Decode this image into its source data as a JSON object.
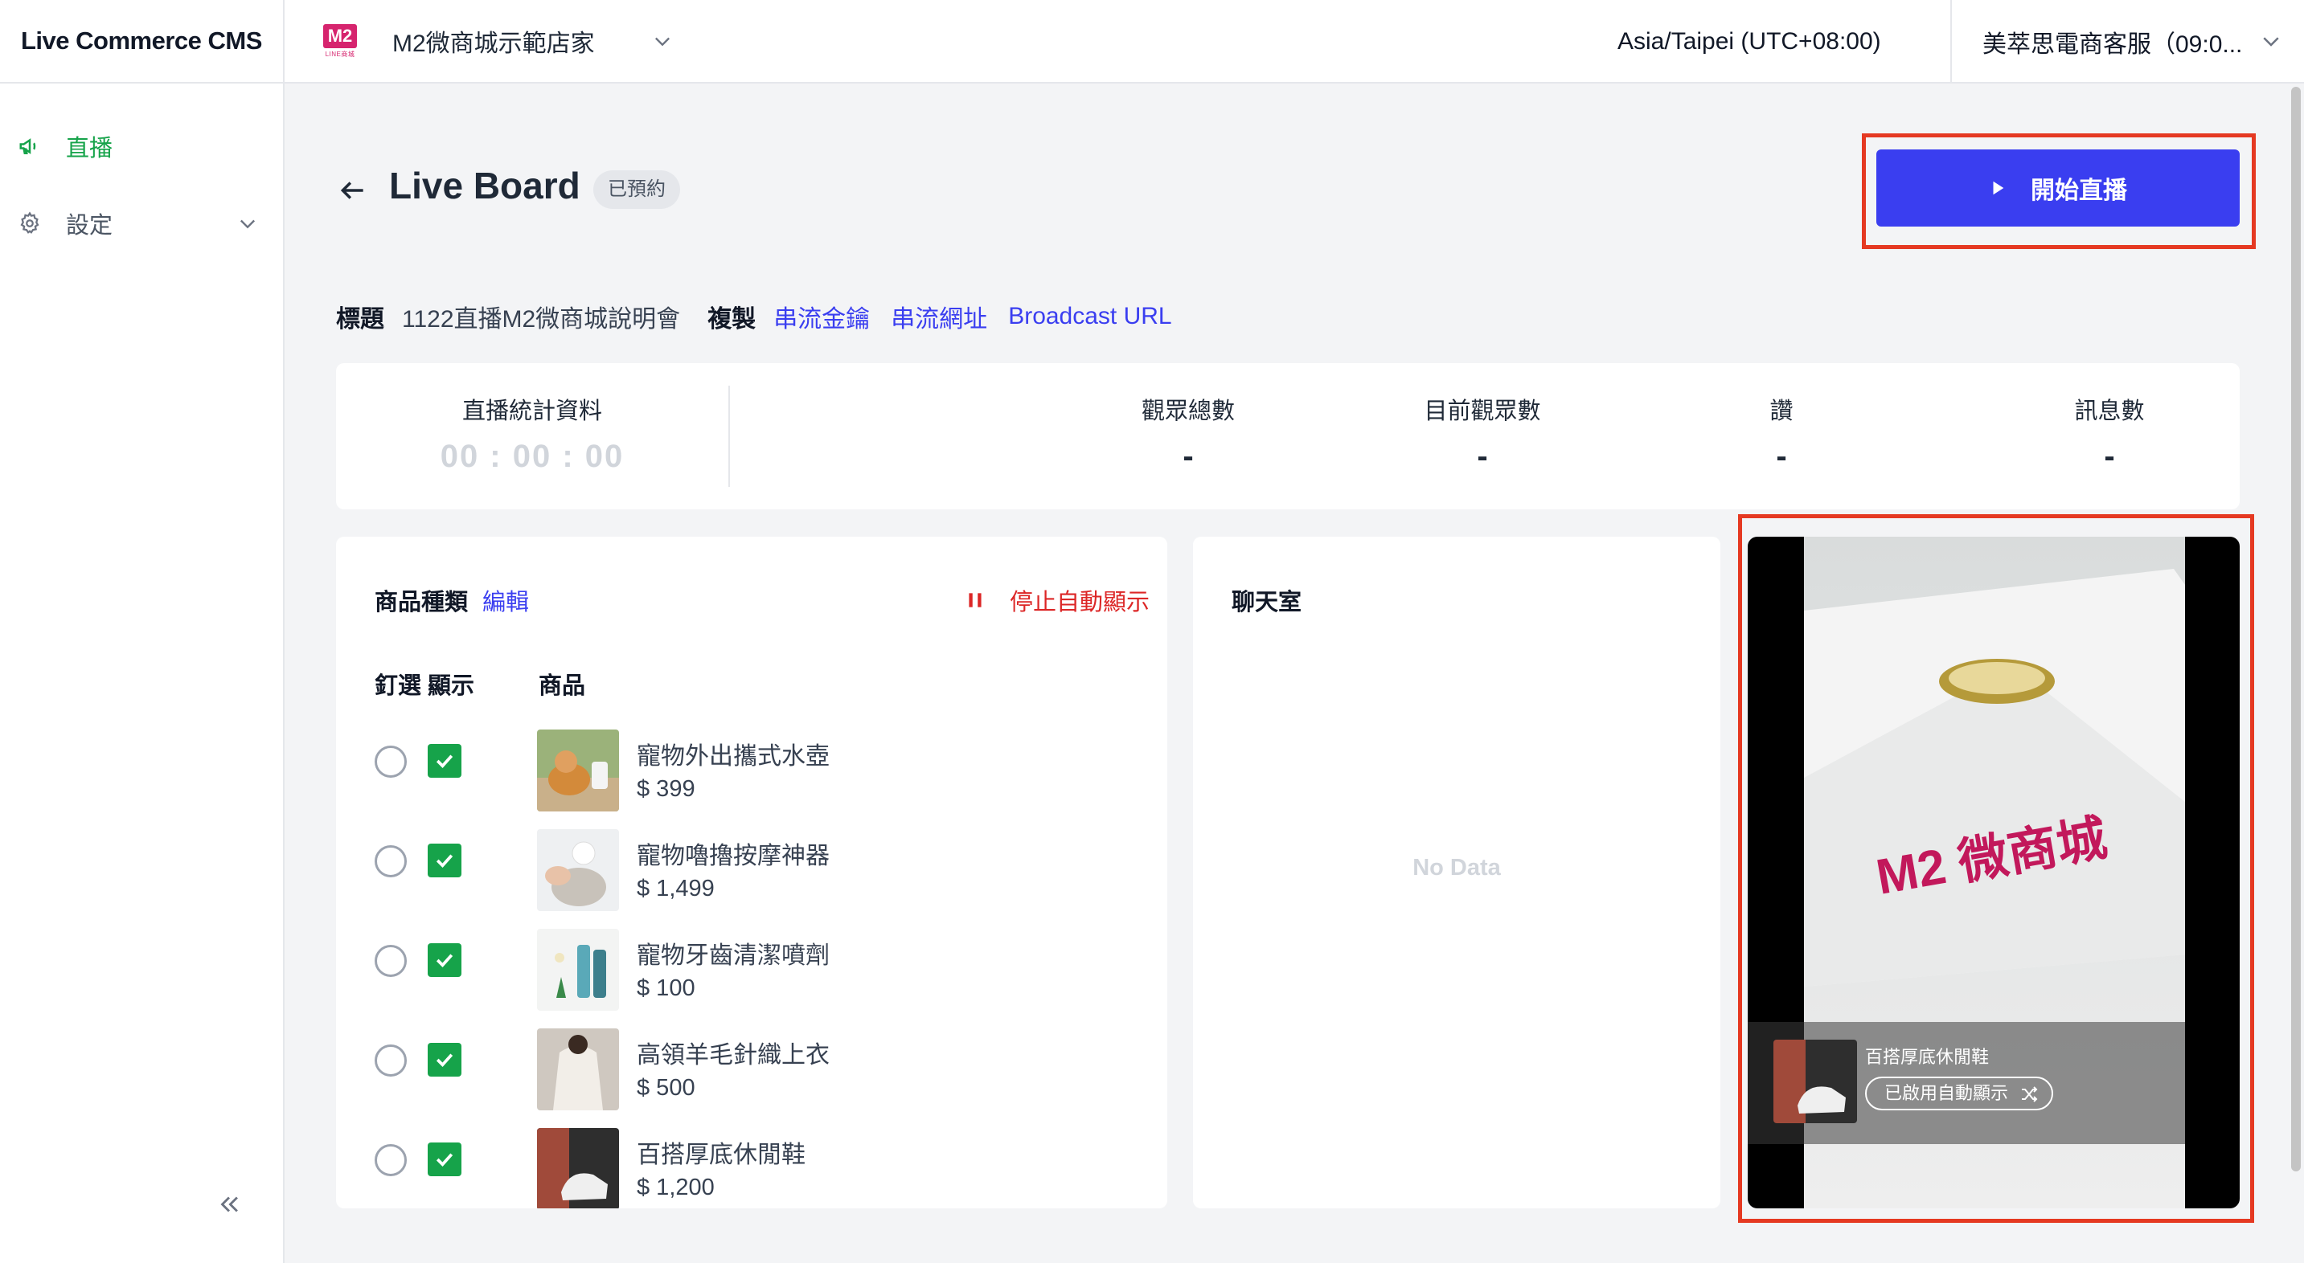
{
  "app": {
    "title": "Live Commerce CMS"
  },
  "store": {
    "logo_text": "M2",
    "logo_sub": "LINE商城",
    "name": "M2微商城示範店家"
  },
  "header": {
    "timezone": "Asia/Taipei (UTC+08:00)",
    "account": "美萃思電商客服（09:0..."
  },
  "sidebar": {
    "items": [
      {
        "label": "直播",
        "icon": "megaphone-icon",
        "active": true
      },
      {
        "label": "設定",
        "icon": "gear-icon",
        "active": false
      }
    ]
  },
  "page": {
    "title": "Live Board",
    "status_badge": "已預約",
    "start_button": "開始直播"
  },
  "meta": {
    "title_label": "標題",
    "title_value": "1122直播M2微商城說明會",
    "copy_label": "複製",
    "links": [
      "串流金鑰",
      "串流網址",
      "Broadcast URL"
    ]
  },
  "stats": {
    "live_stats_label": "直播統計資料",
    "timer": "00 : 00 : 00",
    "items": [
      {
        "label": "觀眾總數",
        "value": "-"
      },
      {
        "label": "目前觀眾數",
        "value": "-"
      },
      {
        "label": "讚",
        "value": "-"
      },
      {
        "label": "訊息數",
        "value": "-"
      }
    ]
  },
  "products": {
    "category_label": "商品種類",
    "edit_label": "編輯",
    "stop_auto_label": "停止自動顯示",
    "col_pin": "釘選",
    "col_show": "顯示",
    "col_product": "商品",
    "items": [
      {
        "name": "寵物外出攜式水壺",
        "price": "$ 399",
        "pinned": false,
        "shown": true
      },
      {
        "name": "寵物嚕擼按摩神器",
        "price": "$ 1,499",
        "pinned": false,
        "shown": true
      },
      {
        "name": "寵物牙齒清潔噴劑",
        "price": "$ 100",
        "pinned": false,
        "shown": true
      },
      {
        "name": "高領羊毛針織上衣",
        "price": "$ 500",
        "pinned": false,
        "shown": true
      },
      {
        "name": "百搭厚底休閒鞋",
        "price": "$ 1,200",
        "pinned": false,
        "shown": true
      }
    ]
  },
  "chat": {
    "title": "聊天室",
    "empty": "No Data"
  },
  "video": {
    "scene_text": "M2 微商城",
    "overlay_product": "百搭厚底休閒鞋",
    "overlay_pill": "已啟用自動顯示"
  },
  "colors": {
    "accent": "#3a3ef0",
    "success": "#16a34a",
    "danger": "#dc2626",
    "highlight": "#e53922",
    "brand": "#d6246e"
  }
}
